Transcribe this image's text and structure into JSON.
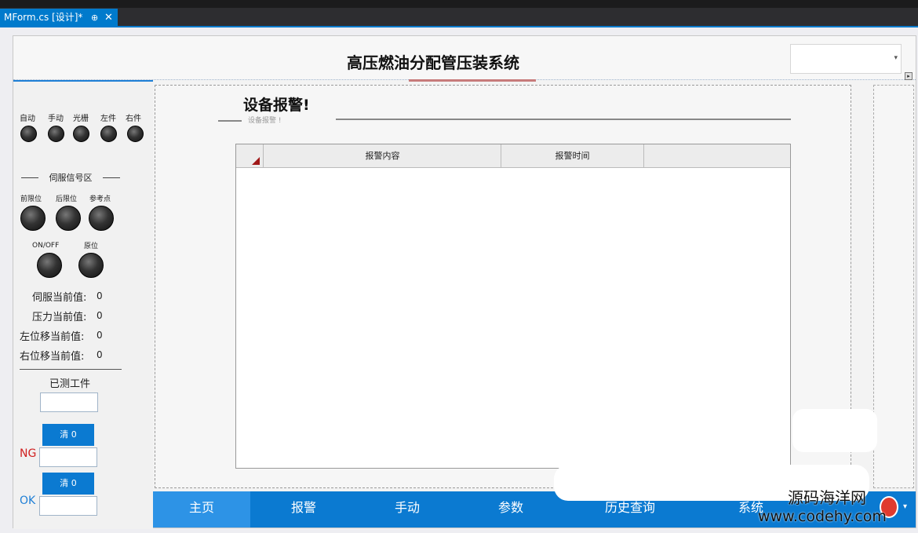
{
  "ide": {
    "tab_label": "MForm.cs [设计]*",
    "pin_glyph": "⊕",
    "close_glyph": "✕"
  },
  "header": {
    "title": "高压燃油分配管压装系统"
  },
  "left_panel": {
    "top_leds": [
      "自动",
      "手动",
      "光栅",
      "左件",
      "右件"
    ],
    "servo_section_label": "伺服信号区",
    "servo_leds": [
      "前限位",
      "后限位",
      "参考点"
    ],
    "extra_leds": [
      "ON/OFF",
      "原位"
    ],
    "values": [
      {
        "label": "伺服当前值:",
        "value": "0"
      },
      {
        "label": "压力当前值:",
        "value": "0"
      },
      {
        "label": "左位移当前值:",
        "value": "0"
      },
      {
        "label": "右位移当前值:",
        "value": "0"
      }
    ],
    "tested_label": "已测工件",
    "clear_ng_label": "清 0",
    "clear_ok_label": "清 0",
    "ng_label": "NG",
    "ok_label": "OK"
  },
  "main": {
    "alarm_title": "设备报警!",
    "alarm_subtitle": "设备报警 !",
    "columns": [
      "报警内容",
      "报警时间"
    ]
  },
  "nav": {
    "items": [
      "主页",
      "报警",
      "手动",
      "参数",
      "历史查询",
      "系统"
    ],
    "active_index": 0
  },
  "watermark": {
    "line1": "源码海洋网",
    "line2": "www.codehy.com"
  },
  "colors": {
    "accent": "#0b7ad1",
    "ide_blue": "#007acc",
    "ng_red": "#d02020"
  }
}
